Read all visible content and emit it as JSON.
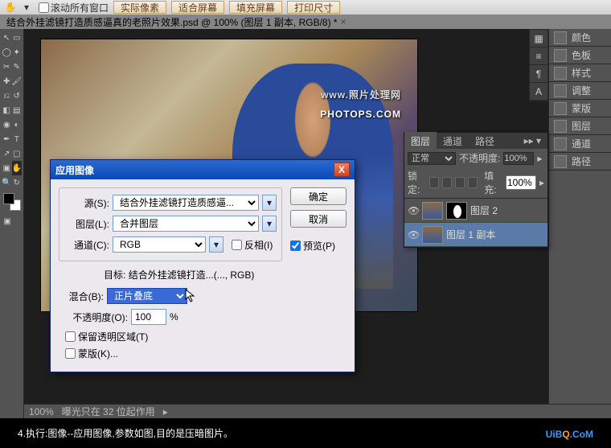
{
  "topbar": {
    "scroll_all_windows": "滚动所有窗口",
    "btn_actual": "实际像素",
    "btn_fit": "适合屏幕",
    "btn_fill": "填充屏幕",
    "btn_print": "打印尺寸"
  },
  "doc_tab": "结合外挂滤镜打造质感逼真的老照片效果.psd @ 100% (图层 1 副本, RGB/8) *",
  "watermark": {
    "sub": "www.",
    "main": "照片处理网",
    "brand": "PHOTOPS.COM"
  },
  "statusbar": {
    "zoom": "100%",
    "info": "曝光只在 32 位起作用"
  },
  "right_tabs": {
    "color": "颜色",
    "swatch": "色板",
    "style": "样式",
    "adjust": "调整",
    "mask": "蒙版",
    "layer": "图层",
    "channel": "通道",
    "path": "路径"
  },
  "layers_panel": {
    "tabs": {
      "layer": "图层",
      "channel": "通道",
      "path": "路径"
    },
    "blend_mode": "正常",
    "opacity_label": "不透明度:",
    "opacity": "100%",
    "lock_label": "锁定:",
    "fill_label": "填充:",
    "fill": "100%",
    "rows": [
      {
        "name": "图层 2"
      },
      {
        "name": "图层 1 副本"
      }
    ]
  },
  "dialog": {
    "title": "应用图像",
    "source_label": "源(S):",
    "source_value": "结合外挂滤镜打造质感逼...",
    "layer_label": "图层(L):",
    "layer_value": "合并图层",
    "channel_label": "通道(C):",
    "channel_value": "RGB",
    "invert": "反相(I)",
    "target_label": "目标:",
    "target_value": "结合外挂滤镜打造...(..., RGB)",
    "blend_label": "混合(B):",
    "blend_value": "正片叠底",
    "opacity_label": "不透明度(O):",
    "opacity_value": "100",
    "opacity_pct": "%",
    "preserve": "保留透明区域(T)",
    "mask": "蒙版(K)...",
    "ok": "确定",
    "cancel": "取消",
    "preview": "预览(P)"
  },
  "caption": {
    "step": "4.",
    "text": "执行:图像--应用图像,参数如图,目的是压暗图片。",
    "logo1": "UiB",
    "logo2": "Q",
    "logo3": ".CoM"
  }
}
